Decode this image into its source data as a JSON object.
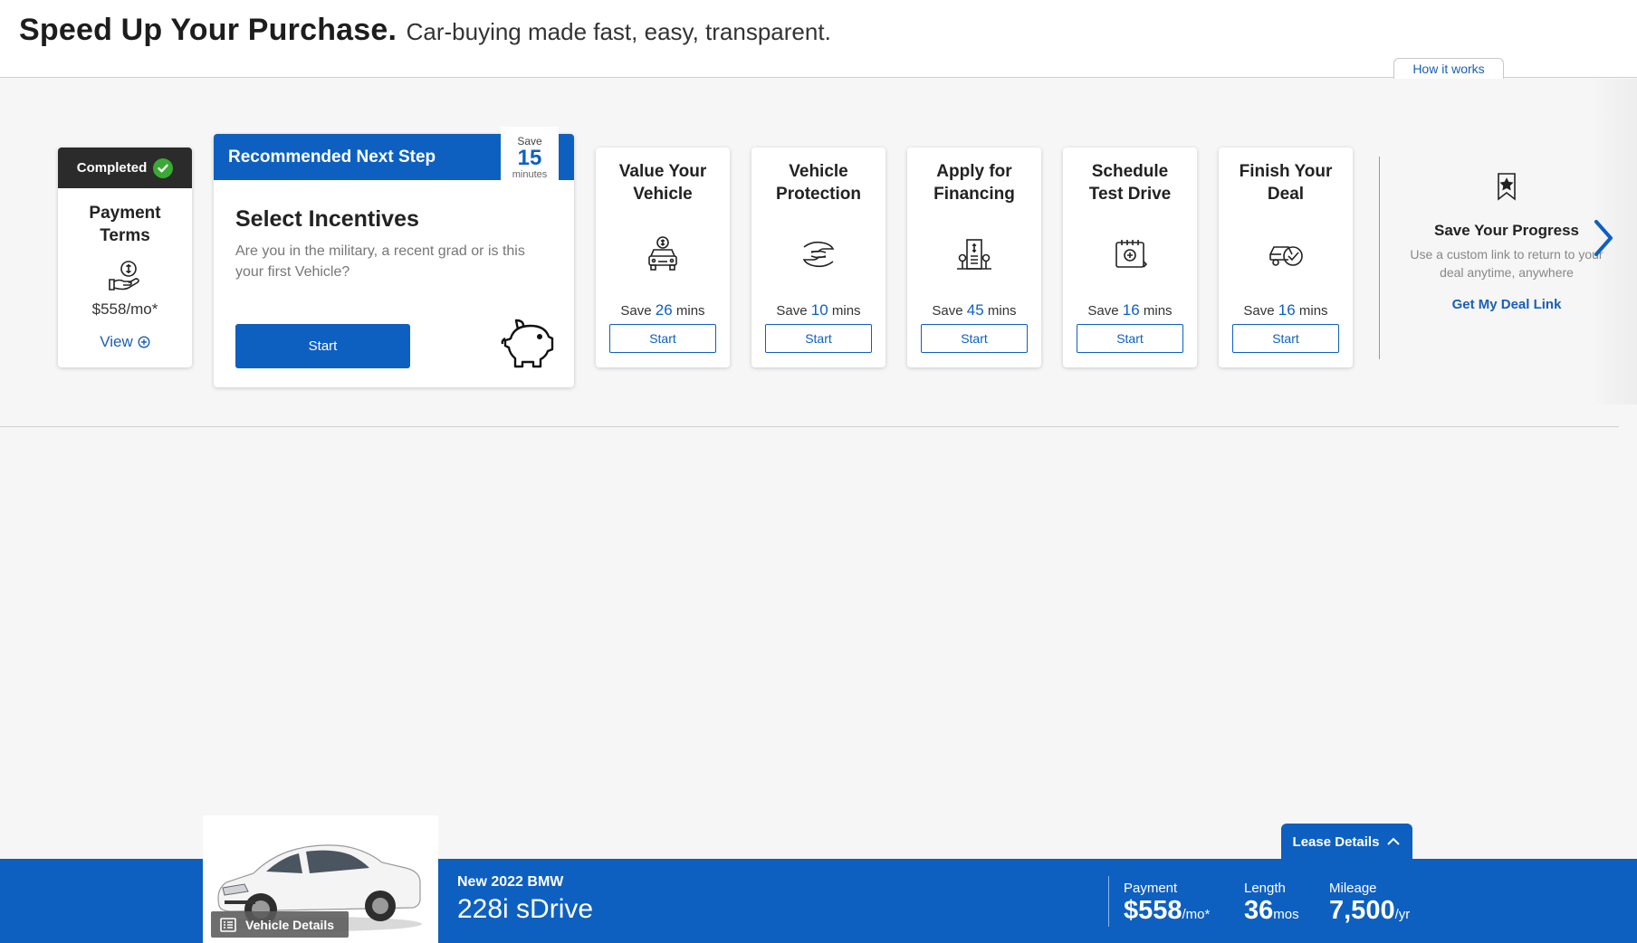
{
  "header": {
    "headline": "Speed Up Your Purchase.",
    "subheadline": "Car-buying made fast, easy, transparent.",
    "how_it_works": "How it works"
  },
  "completed_step": {
    "badge": "Completed",
    "title_line1": "Payment",
    "title_line2": "Terms",
    "price": "$558/mo*",
    "view_label": "View",
    "icon": "money-hand-icon"
  },
  "recommended": {
    "header": "Recommended Next Step",
    "title": "Select Incentives",
    "description": "Are you in the military, a recent grad or is this your first Vehicle?",
    "start_label": "Start",
    "ribbon": {
      "save": "Save",
      "minutes": "15",
      "unit": "minutes"
    },
    "icon": "piggy-bank-icon"
  },
  "steps": [
    {
      "title1": "Value Your",
      "title2": "Vehicle",
      "save_prefix": "Save",
      "mins": "26",
      "save_suffix": "mins",
      "start": "Start",
      "icon": "car-value-icon"
    },
    {
      "title1": "Vehicle",
      "title2": "Protection",
      "save_prefix": "Save",
      "mins": "10",
      "save_suffix": "mins",
      "start": "Start",
      "icon": "protection-hands-icon"
    },
    {
      "title1": "Apply for",
      "title2": "Financing",
      "save_prefix": "Save",
      "mins": "45",
      "save_suffix": "mins",
      "start": "Start",
      "icon": "bank-financing-icon"
    },
    {
      "title1": "Schedule",
      "title2": "Test Drive",
      "save_prefix": "Save",
      "mins": "16",
      "save_suffix": "mins",
      "start": "Start",
      "icon": "calendar-icon"
    },
    {
      "title1": "Finish Your",
      "title2": "Deal",
      "save_prefix": "Save",
      "mins": "16",
      "save_suffix": "mins",
      "start": "Start",
      "icon": "car-check-icon"
    }
  ],
  "save_progress": {
    "title": "Save Your Progress",
    "description": "Use a custom link to return to your deal anytime, anywhere",
    "link": "Get My Deal Link",
    "icon": "bookmark-star-icon"
  },
  "vehicle": {
    "year_make": "New 2022 BMW",
    "model": "228i sDrive",
    "details_label": "Vehicle Details",
    "lease_details": "Lease Details",
    "payment": {
      "label": "Payment",
      "value": "$558",
      "unit": "/mo*"
    },
    "length": {
      "label": "Length",
      "value": "36",
      "unit": "mos"
    },
    "mileage": {
      "label": "Mileage",
      "value": "7,500",
      "unit": "/yr"
    }
  },
  "colors": {
    "primary": "#0d60c0",
    "dark": "#2b2b2b",
    "success": "#3aaa35"
  }
}
